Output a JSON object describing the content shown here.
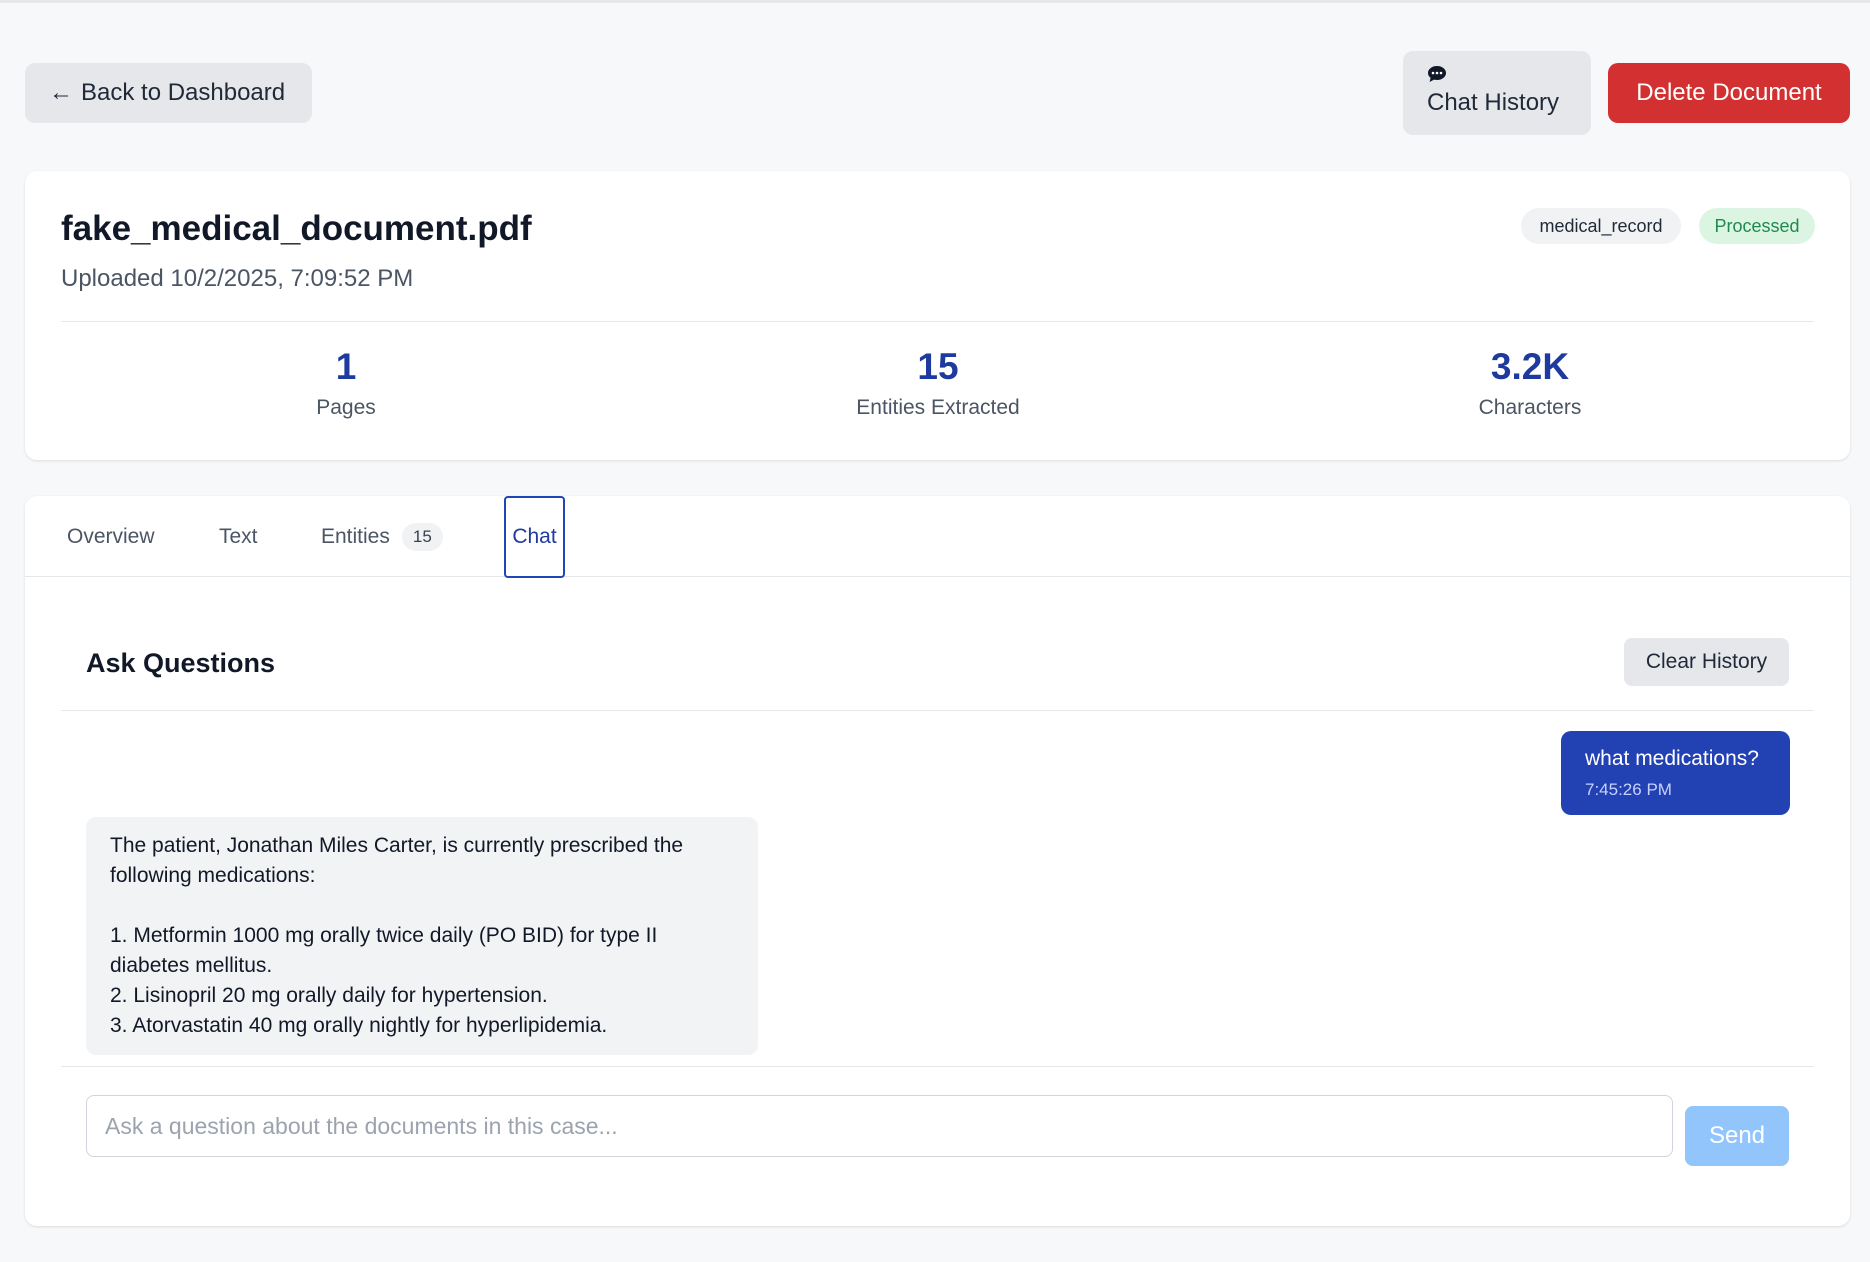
{
  "header": {
    "back_label": "Back to Dashboard",
    "chat_history_label": "Chat History",
    "delete_label": "Delete Document"
  },
  "document": {
    "filename": "fake_medical_document.pdf",
    "uploaded": "Uploaded 10/2/2025, 7:09:52 PM",
    "type_badge": "medical_record",
    "status_badge": "Processed",
    "stats": [
      {
        "value": "1",
        "label": "Pages"
      },
      {
        "value": "15",
        "label": "Entities Extracted"
      },
      {
        "value": "3.2K",
        "label": "Characters"
      }
    ]
  },
  "tabs": {
    "items": [
      {
        "label": "Overview"
      },
      {
        "label": "Text"
      },
      {
        "label": "Entities",
        "count": "15"
      },
      {
        "label": "Chat"
      }
    ],
    "active": "Chat"
  },
  "chat": {
    "title": "Ask Questions",
    "clear_label": "Clear History",
    "user_message": {
      "text": "what medications?",
      "time": "7:45:26 PM"
    },
    "assistant_message": {
      "intro": "The patient, Jonathan Miles Carter, is currently prescribed the following medications:",
      "items": [
        "1. Metformin 1000 mg orally twice daily (PO BID) for type II diabetes mellitus.",
        "2. Lisinopril 20 mg orally daily for hypertension.",
        "3. Atorvastatin 40 mg orally nightly for hyperlipidemia."
      ]
    },
    "input_placeholder": "Ask a question about the documents in this case...",
    "send_label": "Send"
  },
  "colors": {
    "accent": "#1e3a9e",
    "user_bubble": "#2241b3",
    "delete": "#d33131",
    "status_green": "#1f8a4c",
    "send_disabled": "#93c5fd"
  }
}
